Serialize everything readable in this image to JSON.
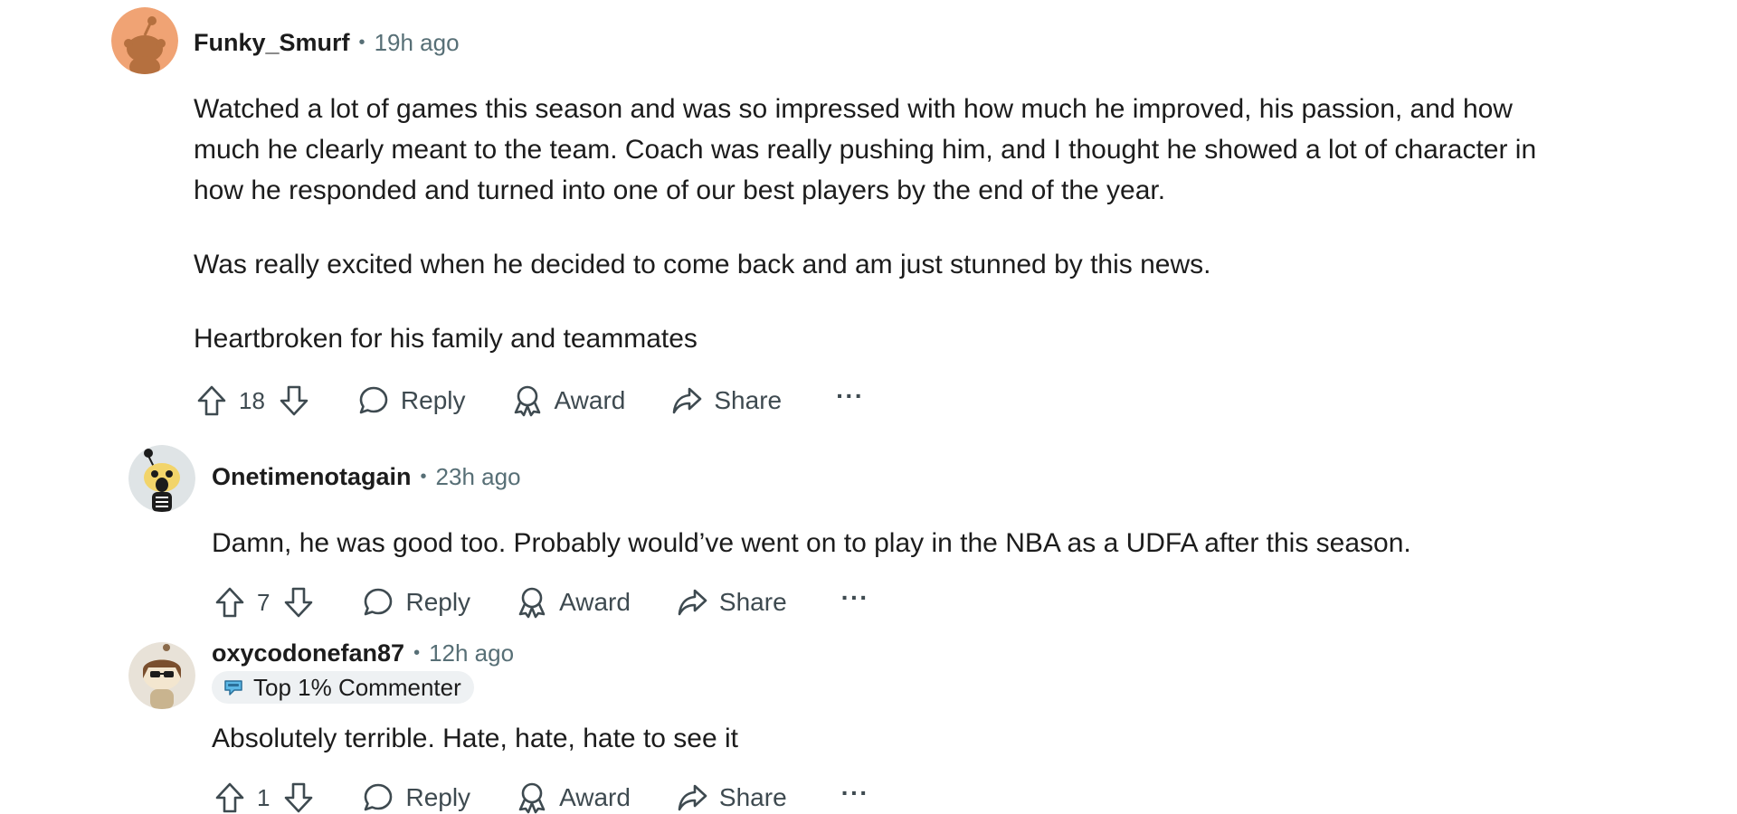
{
  "comments": [
    {
      "username": "Funky_Smurf",
      "separator": "•",
      "time": "19h ago",
      "avatar_icon": "snoo-orange-avatar",
      "paragraphs": [
        "Watched a lot of games this season and was so impressed with how much he improved, his passion, and how much he clearly meant to the team. Coach was really pushing him, and I thought he showed a lot of character in how he responded and turned into one of our best players by the end of the year.",
        "Was really excited when he decided to come back and am just stunned by this news.",
        "Heartbroken for his family and teammates"
      ],
      "score": "18",
      "reply_label": "Reply",
      "award_label": "Award",
      "share_label": "Share",
      "more_label": "···"
    },
    {
      "username": "Onetimenotagain",
      "separator": "•",
      "time": "23h ago",
      "avatar_icon": "snoo-skeleton-avatar",
      "paragraphs": [
        "Damn, he was good too. Probably would’ve went on to play in the NBA as a UDFA after this season."
      ],
      "score": "7",
      "reply_label": "Reply",
      "award_label": "Award",
      "share_label": "Share",
      "more_label": "···"
    },
    {
      "username": "oxycodonefan87",
      "separator": "•",
      "time": "12h ago",
      "avatar_icon": "snoo-sunglasses-avatar",
      "badge": "Top 1% Commenter",
      "badge_icon": "commenter-badge-icon",
      "paragraphs": [
        "Absolutely terrible. Hate, hate, hate to see it"
      ],
      "score": "1",
      "reply_label": "Reply",
      "award_label": "Award",
      "share_label": "Share",
      "more_label": "···"
    }
  ],
  "colors": {
    "text": "#1c1c1c",
    "meta": "#576f76",
    "action": "#3e4a50",
    "badge_bg": "#eef1f3",
    "avatar_orange": "#f0a374"
  }
}
